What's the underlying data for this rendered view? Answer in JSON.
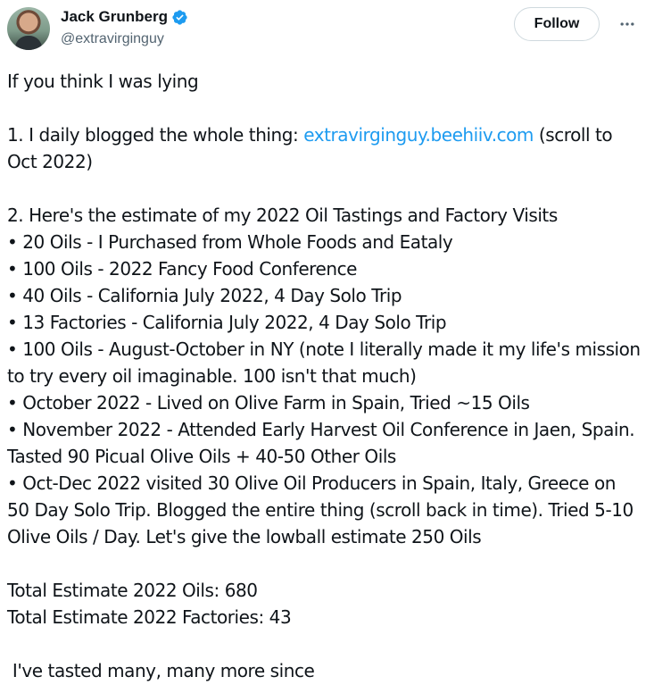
{
  "author": {
    "name": "Jack Grunberg",
    "handle": "@extravirginguy",
    "verified_color": "#1d9bf0"
  },
  "actions": {
    "follow_label": "Follow",
    "more_icon": "more-horizontal-icon"
  },
  "tweet": {
    "intro": "If you think I was lying",
    "point1_prefix": "1. I daily blogged the whole thing: ",
    "point1_link": "extravirginguy.beehiiv.com",
    "point1_suffix": " (scroll to Oct 2022)",
    "point2_heading": "2. Here's the estimate of my 2022 Oil Tastings and Factory Visits",
    "bullets": [
      "• 20 Oils - I Purchased from Whole Foods and Eataly",
      "• 100 Oils - 2022 Fancy Food Conference",
      "• 40 Oils - California July 2022, 4 Day Solo Trip",
      "• 13 Factories - California July 2022, 4 Day Solo Trip",
      "• 100 Oils - August-October in NY (note I literally made it my life's mission to try every oil imaginable. 100 isn't that much)",
      "• October 2022 - Lived on Olive Farm in Spain, Tried ~15 Oils",
      "• November 2022 - Attended Early Harvest Oil Conference in Jaen, Spain. Tasted 90 Picual Olive Oils + 40-50 Other Oils",
      "• Oct-Dec 2022 visited 30 Olive Oil Producers in Spain, Italy, Greece on 50 Day Solo Trip. Blogged the entire thing (scroll back in time). Tried 5-10 Olive Oils / Day. Let's give the lowball estimate 250 Oils"
    ],
    "total_oils": "Total Estimate 2022 Oils: 680",
    "total_factories": "Total Estimate 2022 Factories: 43",
    "closing": " I've tasted many, many more since"
  }
}
